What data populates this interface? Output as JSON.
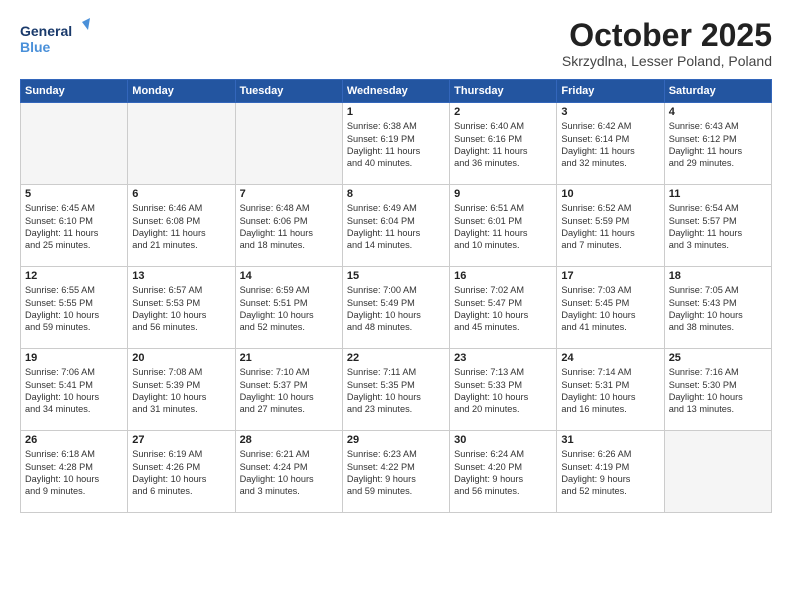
{
  "logo": {
    "line1": "General",
    "line2": "Blue"
  },
  "title": "October 2025",
  "location": "Skrzydlna, Lesser Poland, Poland",
  "days_of_week": [
    "Sunday",
    "Monday",
    "Tuesday",
    "Wednesday",
    "Thursday",
    "Friday",
    "Saturday"
  ],
  "weeks": [
    [
      {
        "day": "",
        "lines": []
      },
      {
        "day": "",
        "lines": []
      },
      {
        "day": "",
        "lines": []
      },
      {
        "day": "1",
        "lines": [
          "Sunrise: 6:38 AM",
          "Sunset: 6:19 PM",
          "Daylight: 11 hours",
          "and 40 minutes."
        ]
      },
      {
        "day": "2",
        "lines": [
          "Sunrise: 6:40 AM",
          "Sunset: 6:16 PM",
          "Daylight: 11 hours",
          "and 36 minutes."
        ]
      },
      {
        "day": "3",
        "lines": [
          "Sunrise: 6:42 AM",
          "Sunset: 6:14 PM",
          "Daylight: 11 hours",
          "and 32 minutes."
        ]
      },
      {
        "day": "4",
        "lines": [
          "Sunrise: 6:43 AM",
          "Sunset: 6:12 PM",
          "Daylight: 11 hours",
          "and 29 minutes."
        ]
      }
    ],
    [
      {
        "day": "5",
        "lines": [
          "Sunrise: 6:45 AM",
          "Sunset: 6:10 PM",
          "Daylight: 11 hours",
          "and 25 minutes."
        ]
      },
      {
        "day": "6",
        "lines": [
          "Sunrise: 6:46 AM",
          "Sunset: 6:08 PM",
          "Daylight: 11 hours",
          "and 21 minutes."
        ]
      },
      {
        "day": "7",
        "lines": [
          "Sunrise: 6:48 AM",
          "Sunset: 6:06 PM",
          "Daylight: 11 hours",
          "and 18 minutes."
        ]
      },
      {
        "day": "8",
        "lines": [
          "Sunrise: 6:49 AM",
          "Sunset: 6:04 PM",
          "Daylight: 11 hours",
          "and 14 minutes."
        ]
      },
      {
        "day": "9",
        "lines": [
          "Sunrise: 6:51 AM",
          "Sunset: 6:01 PM",
          "Daylight: 11 hours",
          "and 10 minutes."
        ]
      },
      {
        "day": "10",
        "lines": [
          "Sunrise: 6:52 AM",
          "Sunset: 5:59 PM",
          "Daylight: 11 hours",
          "and 7 minutes."
        ]
      },
      {
        "day": "11",
        "lines": [
          "Sunrise: 6:54 AM",
          "Sunset: 5:57 PM",
          "Daylight: 11 hours",
          "and 3 minutes."
        ]
      }
    ],
    [
      {
        "day": "12",
        "lines": [
          "Sunrise: 6:55 AM",
          "Sunset: 5:55 PM",
          "Daylight: 10 hours",
          "and 59 minutes."
        ]
      },
      {
        "day": "13",
        "lines": [
          "Sunrise: 6:57 AM",
          "Sunset: 5:53 PM",
          "Daylight: 10 hours",
          "and 56 minutes."
        ]
      },
      {
        "day": "14",
        "lines": [
          "Sunrise: 6:59 AM",
          "Sunset: 5:51 PM",
          "Daylight: 10 hours",
          "and 52 minutes."
        ]
      },
      {
        "day": "15",
        "lines": [
          "Sunrise: 7:00 AM",
          "Sunset: 5:49 PM",
          "Daylight: 10 hours",
          "and 48 minutes."
        ]
      },
      {
        "day": "16",
        "lines": [
          "Sunrise: 7:02 AM",
          "Sunset: 5:47 PM",
          "Daylight: 10 hours",
          "and 45 minutes."
        ]
      },
      {
        "day": "17",
        "lines": [
          "Sunrise: 7:03 AM",
          "Sunset: 5:45 PM",
          "Daylight: 10 hours",
          "and 41 minutes."
        ]
      },
      {
        "day": "18",
        "lines": [
          "Sunrise: 7:05 AM",
          "Sunset: 5:43 PM",
          "Daylight: 10 hours",
          "and 38 minutes."
        ]
      }
    ],
    [
      {
        "day": "19",
        "lines": [
          "Sunrise: 7:06 AM",
          "Sunset: 5:41 PM",
          "Daylight: 10 hours",
          "and 34 minutes."
        ]
      },
      {
        "day": "20",
        "lines": [
          "Sunrise: 7:08 AM",
          "Sunset: 5:39 PM",
          "Daylight: 10 hours",
          "and 31 minutes."
        ]
      },
      {
        "day": "21",
        "lines": [
          "Sunrise: 7:10 AM",
          "Sunset: 5:37 PM",
          "Daylight: 10 hours",
          "and 27 minutes."
        ]
      },
      {
        "day": "22",
        "lines": [
          "Sunrise: 7:11 AM",
          "Sunset: 5:35 PM",
          "Daylight: 10 hours",
          "and 23 minutes."
        ]
      },
      {
        "day": "23",
        "lines": [
          "Sunrise: 7:13 AM",
          "Sunset: 5:33 PM",
          "Daylight: 10 hours",
          "and 20 minutes."
        ]
      },
      {
        "day": "24",
        "lines": [
          "Sunrise: 7:14 AM",
          "Sunset: 5:31 PM",
          "Daylight: 10 hours",
          "and 16 minutes."
        ]
      },
      {
        "day": "25",
        "lines": [
          "Sunrise: 7:16 AM",
          "Sunset: 5:30 PM",
          "Daylight: 10 hours",
          "and 13 minutes."
        ]
      }
    ],
    [
      {
        "day": "26",
        "lines": [
          "Sunrise: 6:18 AM",
          "Sunset: 4:28 PM",
          "Daylight: 10 hours",
          "and 9 minutes."
        ]
      },
      {
        "day": "27",
        "lines": [
          "Sunrise: 6:19 AM",
          "Sunset: 4:26 PM",
          "Daylight: 10 hours",
          "and 6 minutes."
        ]
      },
      {
        "day": "28",
        "lines": [
          "Sunrise: 6:21 AM",
          "Sunset: 4:24 PM",
          "Daylight: 10 hours",
          "and 3 minutes."
        ]
      },
      {
        "day": "29",
        "lines": [
          "Sunrise: 6:23 AM",
          "Sunset: 4:22 PM",
          "Daylight: 9 hours",
          "and 59 minutes."
        ]
      },
      {
        "day": "30",
        "lines": [
          "Sunrise: 6:24 AM",
          "Sunset: 4:20 PM",
          "Daylight: 9 hours",
          "and 56 minutes."
        ]
      },
      {
        "day": "31",
        "lines": [
          "Sunrise: 6:26 AM",
          "Sunset: 4:19 PM",
          "Daylight: 9 hours",
          "and 52 minutes."
        ]
      },
      {
        "day": "",
        "lines": []
      }
    ]
  ]
}
